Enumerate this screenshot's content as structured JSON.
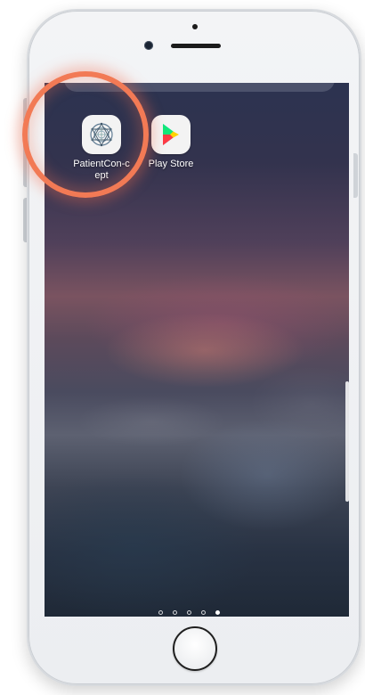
{
  "home_screen": {
    "apps": [
      {
        "name": "PatientConcept",
        "label": "PatientCon-cept",
        "icon": "patientconcept-logo-icon"
      },
      {
        "name": "Play Store",
        "label": "Play Store",
        "icon": "play-store-icon"
      }
    ],
    "page_indicator": {
      "total_pages": 5,
      "active_page": 5
    },
    "highlight": {
      "target": "PatientConcept",
      "color": "#f27a55"
    }
  },
  "device": {
    "type": "smartphone",
    "frame_color": "#eceef1"
  }
}
